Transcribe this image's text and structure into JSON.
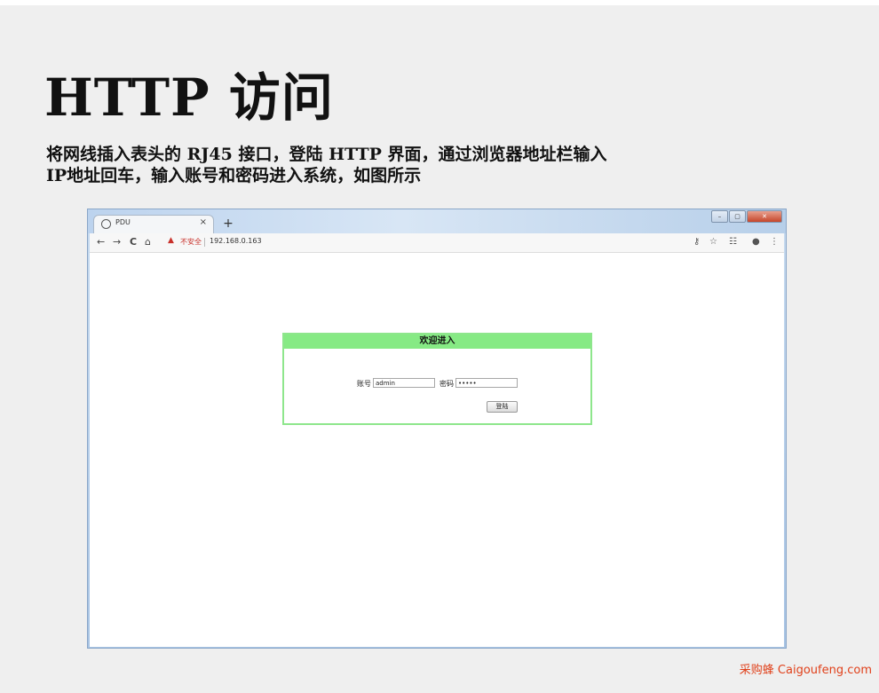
{
  "heading": "HTTP 访问",
  "description": {
    "line1": "将网线插入表头的 RJ45 接口，登陆 HTTP 界面，通过浏览器地址栏输入",
    "line2": "IP地址回车，输入账号和密码进入系统，如图所示"
  },
  "browser": {
    "tab_title": "PDU",
    "tab_close": "×",
    "new_tab": "+",
    "window_buttons": {
      "minimize": "–",
      "maximize": "▢",
      "close": "✕"
    },
    "nav": {
      "back": "←",
      "forward": "→",
      "reload": "C",
      "home": "⌂"
    },
    "address": {
      "warning_icon": "▲",
      "security_label": "不安全",
      "url": "192.168.0.163"
    },
    "right_icons": {
      "key": "⚷",
      "star": "☆",
      "reader": "☷",
      "account": "●",
      "menu": "⋮"
    }
  },
  "login": {
    "title": "欢迎进入",
    "account_label": "账号",
    "account_value": "admin",
    "password_label": "密码",
    "password_value": "•••••",
    "submit_label": "登陆"
  },
  "watermark": "采购蜂 Caigoufeng.com",
  "colors": {
    "panel_green": "#86ea84",
    "watermark": "#e0401a",
    "warning_red": "#c8302a"
  }
}
